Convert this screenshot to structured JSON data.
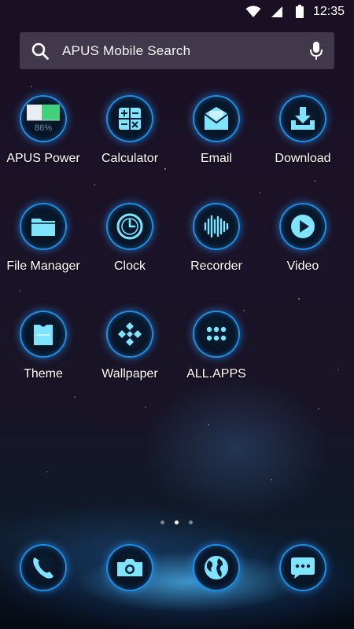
{
  "status": {
    "time": "12:35",
    "icons": [
      "wifi-icon",
      "signal-icon",
      "battery-icon"
    ]
  },
  "search": {
    "placeholder": "APUS Mobile Search",
    "icons": [
      "search-icon",
      "microphone-icon"
    ]
  },
  "apps": [
    {
      "label": "APUS Power",
      "icon": "battery-meter-icon",
      "percent_text": "86%"
    },
    {
      "label": "Calculator",
      "icon": "calculator-icon"
    },
    {
      "label": "Email",
      "icon": "envelope-icon"
    },
    {
      "label": "Download",
      "icon": "download-icon"
    },
    {
      "label": "File Manager",
      "icon": "folder-icon"
    },
    {
      "label": "Clock",
      "icon": "clock-icon"
    },
    {
      "label": "Recorder",
      "icon": "waveform-icon"
    },
    {
      "label": "Video",
      "icon": "play-icon"
    },
    {
      "label": "Theme",
      "icon": "shirt-icon"
    },
    {
      "label": "Wallpaper",
      "icon": "wallpaper-icon"
    },
    {
      "label": "ALL.APPS",
      "icon": "app-grid-icon"
    }
  ],
  "pager": {
    "pages": 3,
    "active_page": 2
  },
  "dock": [
    {
      "icon": "phone-icon"
    },
    {
      "icon": "camera-icon"
    },
    {
      "icon": "globe-icon"
    },
    {
      "icon": "chat-icon"
    }
  ],
  "colors": {
    "accent": "#35c8ff",
    "ring": "#1d8fe0",
    "battery_green": "#3fd27a"
  }
}
